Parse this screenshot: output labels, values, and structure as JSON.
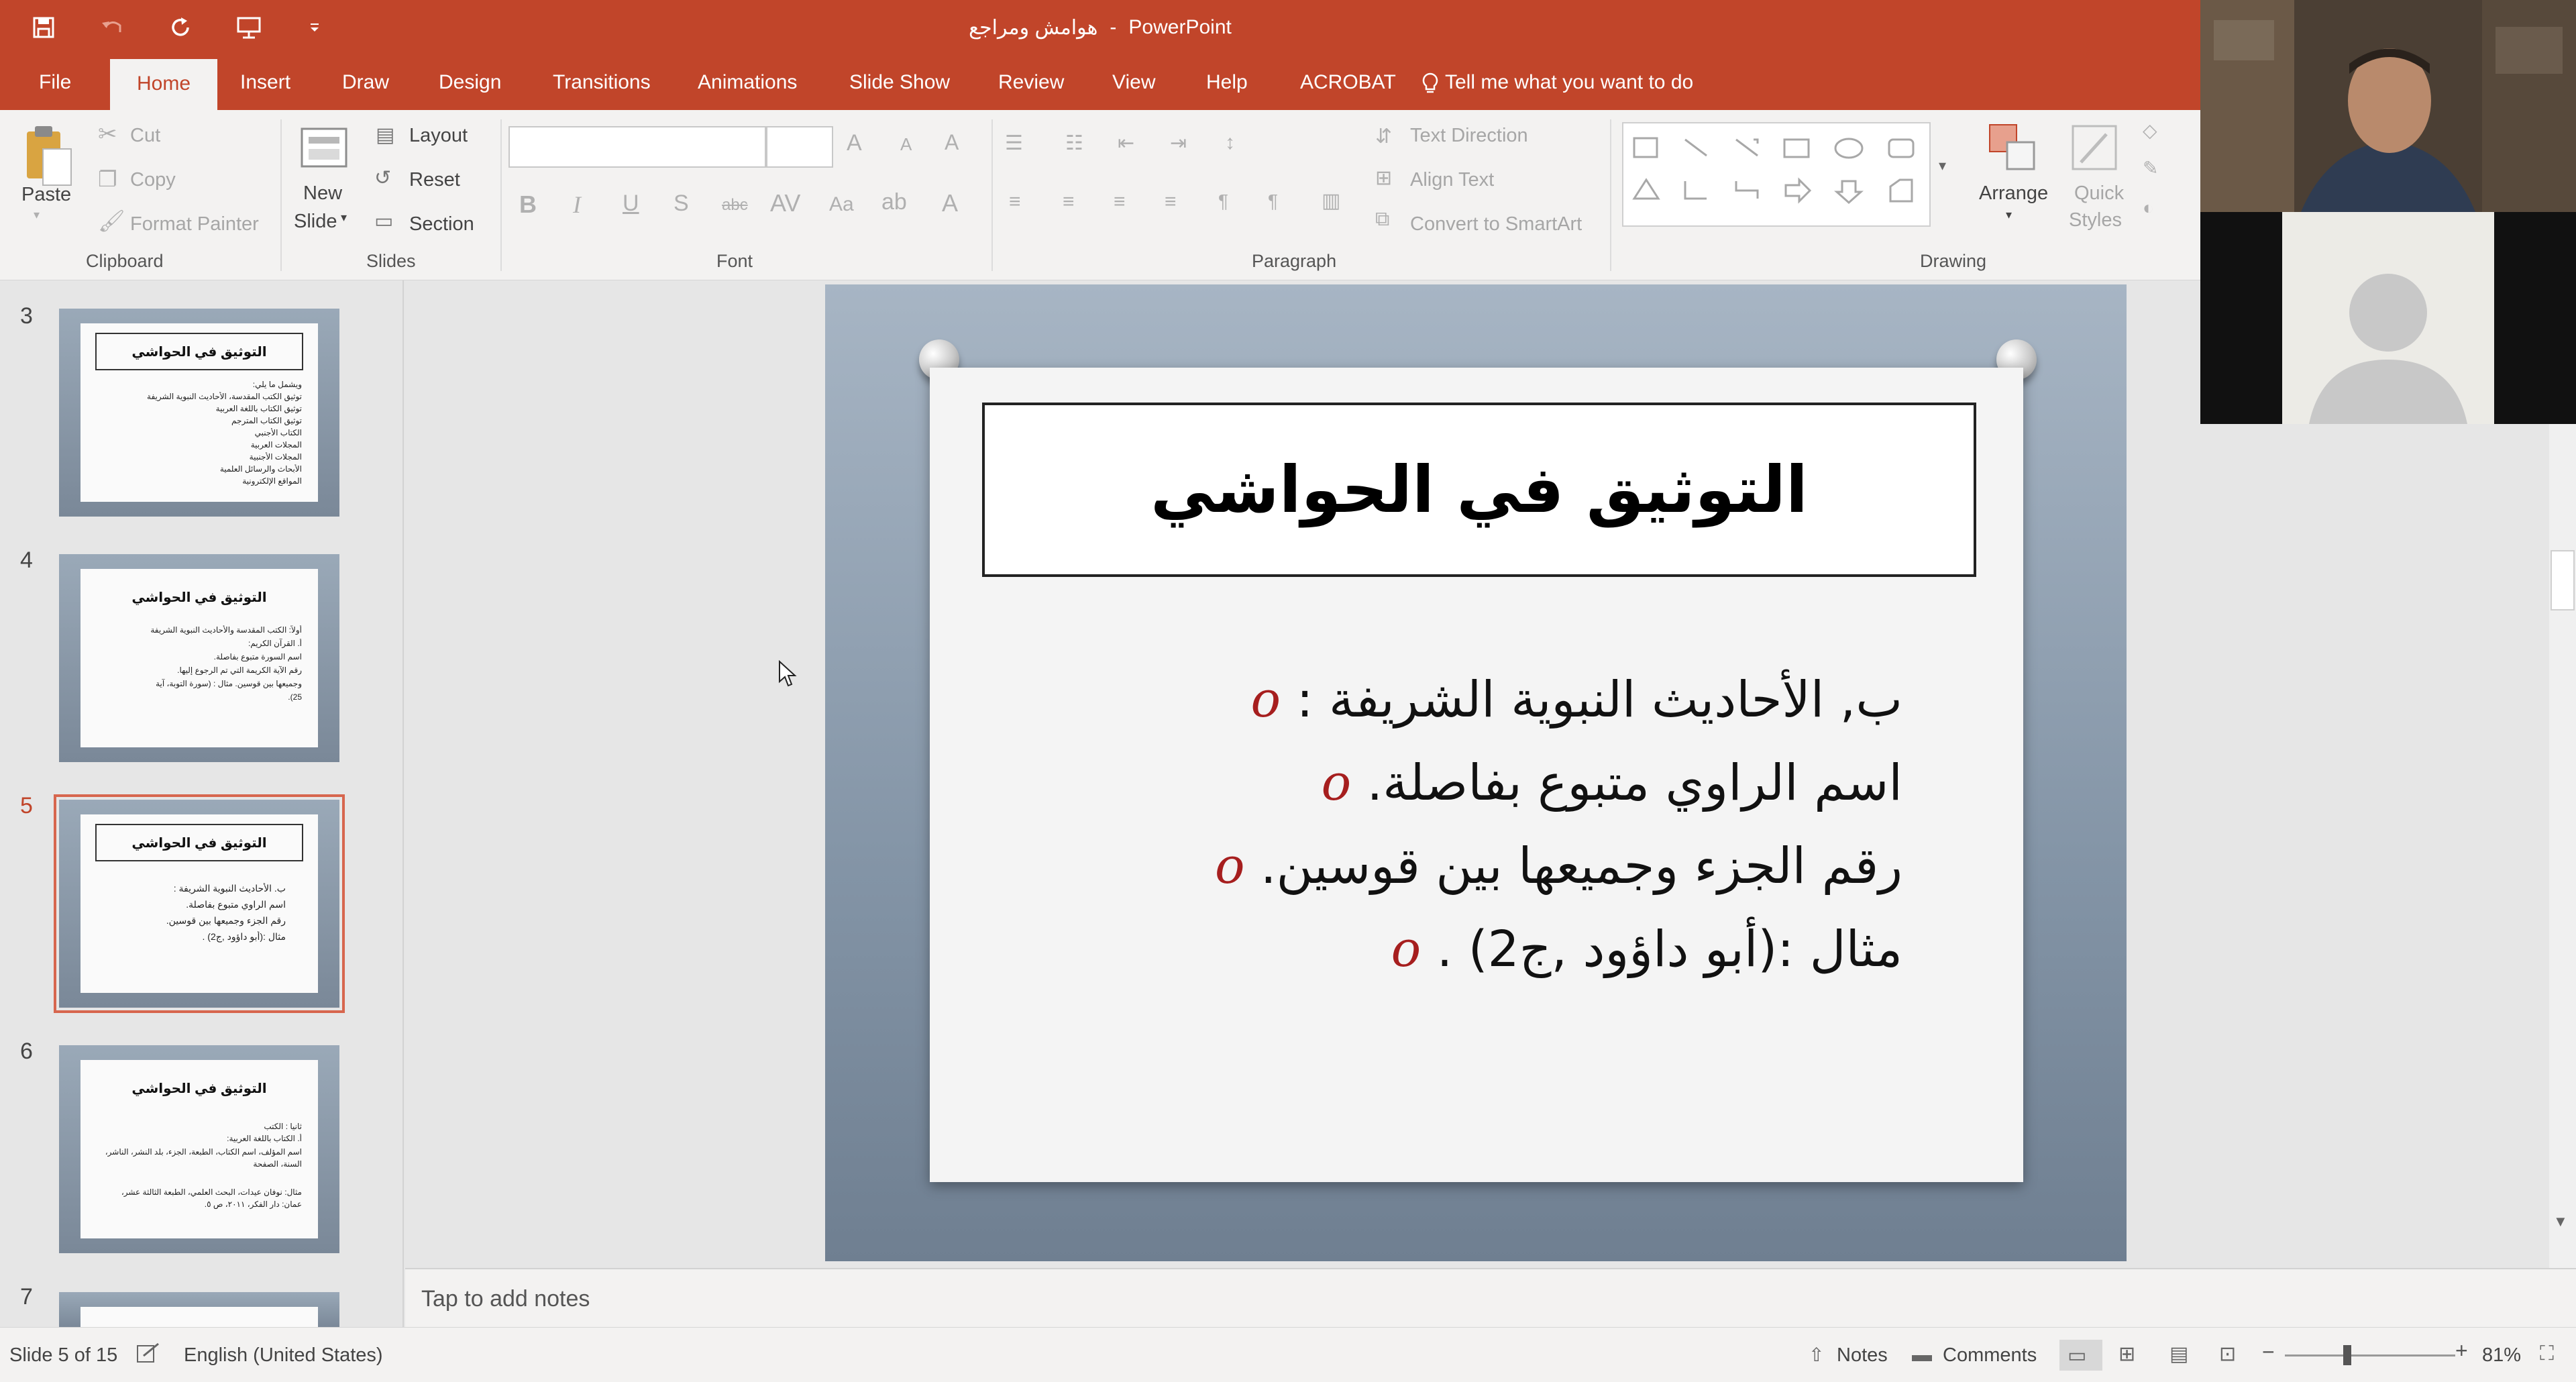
{
  "window": {
    "doc_title": "هوامش ومراجع",
    "separator": "-",
    "app_name": "PowerPoint"
  },
  "tabs": [
    "File",
    "Home",
    "Insert",
    "Draw",
    "Design",
    "Transitions",
    "Animations",
    "Slide Show",
    "Review",
    "View",
    "Help",
    "ACROBAT"
  ],
  "active_tab": "Home",
  "tell_me": "Tell me what you want to do",
  "ribbon": {
    "clipboard": {
      "paste": "Paste",
      "cut": "Cut",
      "copy": "Copy",
      "format_painter": "Format Painter",
      "label": "Clipboard"
    },
    "slides": {
      "new_slide_1": "New",
      "new_slide_2": "Slide",
      "layout": "Layout",
      "reset": "Reset",
      "section": "Section",
      "label": "Slides"
    },
    "font": {
      "label": "Font"
    },
    "paragraph": {
      "text_direction": "Text Direction",
      "align_text": "Align Text",
      "convert_smartart": "Convert to SmartArt",
      "label": "Paragraph"
    },
    "drawing": {
      "arrange": "Arrange",
      "quick_styles_1": "Quick",
      "quick_styles_2": "Styles",
      "label": "Drawing"
    }
  },
  "thumbnails": [
    {
      "num": "3",
      "title": "التوثيق في الحواشي",
      "lines": [
        "ويشمل ما يلي:",
        "توثيق الكتب المقدسة، الأحاديث النبوية الشريفة",
        "توثيق الكتاب باللغة العربية",
        "توثيق الكتاب المترجم",
        "الكتاب الأجنبي",
        "المجلات العربية",
        "المجلات الأجنبية",
        "الأبحاث والرسائل العلمية",
        "المواقع الإلكترونية"
      ]
    },
    {
      "num": "4",
      "title": "التوثيق في الحواشي",
      "lines": [
        "أولاً: الكتب المقدسة والأحاديث النبوية الشريفة",
        "أ. القرآن الكريم:",
        "اسم السورة متبوع بفاصلة.",
        "رقم الآية الكريمة التي تم الرجوع إليها.",
        "وجميعها بين قوسين. مثال : (سورة التوبة، آية",
        "25)."
      ]
    },
    {
      "num": "5",
      "title": "التوثيق في الحواشي",
      "lines": [
        "ب. الأحاديث النبوية الشريفة :",
        "اسم الراوي متبوع بفاصلة.",
        "رقم الجزء وجميعها بين قوسين.",
        "مثال :(أبو داؤود ,ج2) ."
      ]
    },
    {
      "num": "6",
      "title": "التوثيق في الحواشي",
      "lines": [
        "ثانيا : الكتب",
        "أ. الكتاب باللغة العربية:",
        "اسم المؤلف، اسم الكتاب، الطبعة، الجزء، بلد النشر، الناشر،",
        "السنة، الصفحة",
        "مثال: نوفان عيدات، البحث العلمي، الطبعة الثالثة عشر،",
        "عمان: دار الفكر، ٢٠١١، ص ٥."
      ]
    },
    {
      "num": "7",
      "title": "",
      "lines": []
    }
  ],
  "selected_slide": "5",
  "slide": {
    "title": "التوثيق في الحواشي",
    "bullet_mark": "o",
    "bullets": [
      "ب, الأحاديث النبوية الشريفة :",
      "اسم الراوي متبوع بفاصلة.",
      "رقم الجزء وجميعها بين قوسين.",
      "مثال :(أبو داؤود ,ج2) ."
    ]
  },
  "notes_placeholder": "Tap to add notes",
  "status": {
    "slide_info": "Slide 5 of 15",
    "language": "English (United States)",
    "notes": "Notes",
    "comments": "Comments",
    "zoom": "81%"
  },
  "colors": {
    "accent": "#c1452a",
    "bullet_mark": "#a61e1e",
    "selection": "#d7664e"
  }
}
